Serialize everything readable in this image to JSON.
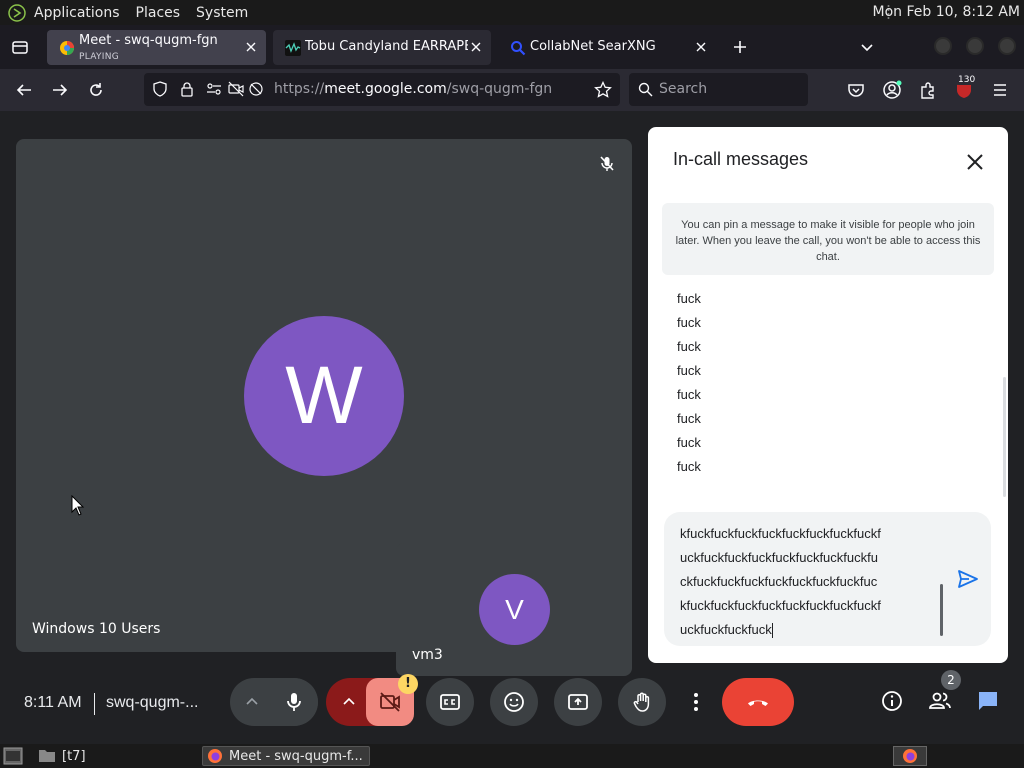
{
  "top_panel": {
    "menus": [
      "Applications",
      "Places",
      "System"
    ],
    "clock": "Mon Feb 10,  8:12 AM"
  },
  "tabs": [
    {
      "title": "Meet - swq-qugm-fgn",
      "subtitle": "PLAYING",
      "favicon": "google-meet-icon"
    },
    {
      "title": "Tobu Candyland EARRAPE b",
      "favicon": "music-wave-icon"
    },
    {
      "title": "CollabNet SearXNG",
      "favicon": "search-icon"
    }
  ],
  "navbar": {
    "url_prefix": "https://",
    "url_host": "meet.google.com",
    "url_path": "/swq-qugm-fgn",
    "search_placeholder": "Search",
    "extension_badge": "130"
  },
  "meet": {
    "main_tile_name": "Windows 10 Users",
    "main_avatar_letter": "W",
    "self_tile_name": "vm3",
    "self_avatar_letter": "V",
    "avatar_color": "#7e57c2"
  },
  "chat": {
    "title": "In-call messages",
    "info": "You can pin a message to make it visible for people who join later. When you leave the call, you won't be able to access this chat.",
    "messages": [
      "fuck",
      "fuck",
      "fuck",
      "fuck",
      "fuck",
      "fuck",
      "fuck",
      "fuck"
    ],
    "compose_lines": [
      "kfuckfuckfuckfuckfuckfuckfuckfuckf",
      "uckfuckfuckfuckfuckfuckfuckfuckfu",
      "ckfuckfuckfuckfuckfuckfuckfuckfuc",
      "kfuckfuckfuckfuckfuckfuckfuckfuckf",
      "uckfuckfuckfuck"
    ]
  },
  "controls": {
    "time": "8:11 AM",
    "meeting_code": "swq-qugm-...",
    "camera_warning": "!",
    "people_count": "2",
    "end_call_color": "#ea4335"
  },
  "taskbar": {
    "workspace": "[t7]",
    "active_window": "Meet - swq-qugm-f..."
  }
}
